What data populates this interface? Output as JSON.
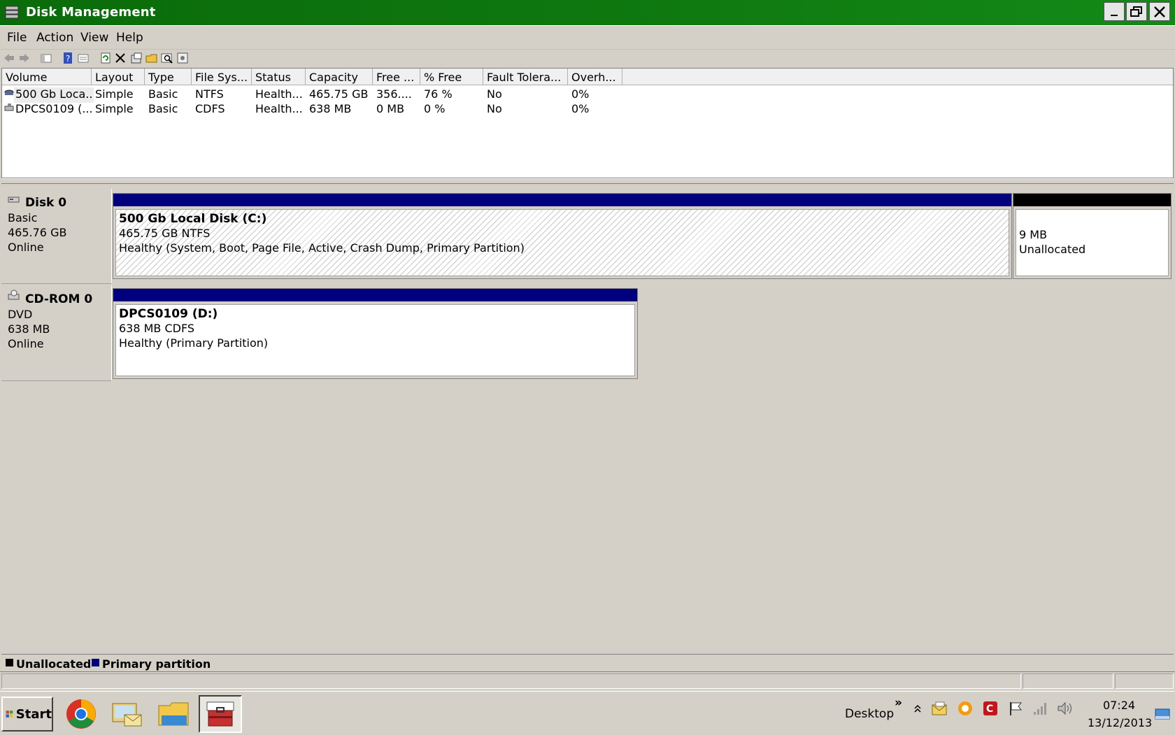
{
  "window": {
    "title": "Disk Management",
    "icon": "disk-management-icon"
  },
  "menu": [
    "File",
    "Action",
    "View",
    "Help"
  ],
  "toolbar_icons": [
    "back-icon",
    "forward-icon",
    "show-hide-console-tree-icon",
    "help-icon",
    "properties-list-icon",
    "refresh-icon",
    "delete-icon",
    "properties-icon",
    "open-icon",
    "explore-icon",
    "settings-icon"
  ],
  "volume_table": {
    "columns": [
      "Volume",
      "Layout",
      "Type",
      "File Sys...",
      "Status",
      "Capacity",
      "Free ...",
      "% Free",
      "Fault Tolera...",
      "Overh..."
    ],
    "rows": [
      [
        "500 Gb Loca...",
        "Simple",
        "Basic",
        "NTFS",
        "Health...",
        "465.75 GB",
        "356....",
        "76 %",
        "No",
        "0%"
      ],
      [
        "DPCS0109 (...",
        "Simple",
        "Basic",
        "CDFS",
        "Health...",
        "638 MB",
        "0 MB",
        "0 %",
        "No",
        "0%"
      ]
    ]
  },
  "disks": [
    {
      "name": "Disk 0",
      "type": "Basic",
      "size": "465.76 GB",
      "status": "Online",
      "partitions": [
        {
          "title": "500 Gb Local Disk  (C:)",
          "size_fs": "465.75 GB NTFS",
          "status": "Healthy (System, Boot, Page File, Active, Crash Dump, Primary Partition)"
        },
        {
          "title": "",
          "size_fs": "9 MB",
          "status": "Unallocated"
        }
      ]
    },
    {
      "name": "CD-ROM 0",
      "type": "DVD",
      "size": "638 MB",
      "status": "Online",
      "partitions": [
        {
          "title": "DPCS0109  (D:)",
          "size_fs": "638 MB CDFS",
          "status": "Healthy (Primary Partition)"
        }
      ]
    }
  ],
  "legend": [
    {
      "label": "Unallocated",
      "color": "#000000"
    },
    {
      "label": "Primary partition",
      "color": "#00007f"
    }
  ],
  "taskbar": {
    "start_label": "Start",
    "apps": [
      "chrome-icon",
      "mail-explorer-icon",
      "file-explorer-icon",
      "toolbox-icon"
    ],
    "desktop_label": "Desktop",
    "chevron": "»",
    "time": "07:24",
    "date": "13/12/2013"
  },
  "colors": {
    "primary_partition": "#00007f",
    "unallocated": "#000000",
    "titlebar": "#0f7a10"
  }
}
